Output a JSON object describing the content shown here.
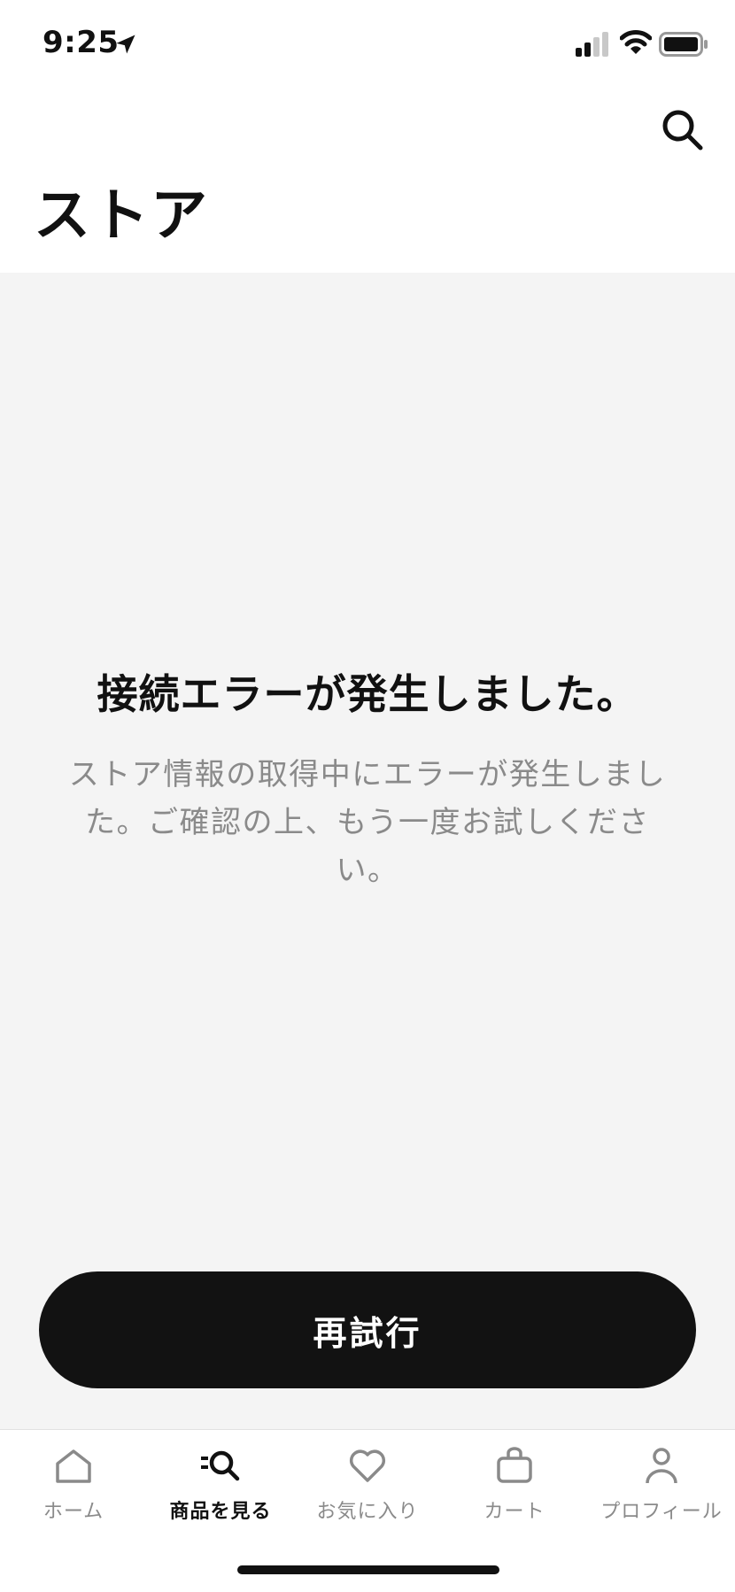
{
  "status_bar": {
    "time": "9:25"
  },
  "header": {
    "title": "ストア",
    "search_icon": "search-icon"
  },
  "error": {
    "title": "接続エラーが発生しました。",
    "message": "ストア情報の取得中にエラーが発生しました。ご確認の上、もう一度お試しください。"
  },
  "retry_button": {
    "label": "再試行"
  },
  "tab_bar": {
    "tabs": [
      {
        "label": "ホーム",
        "icon": "home-icon",
        "active": false
      },
      {
        "label": "商品を見る",
        "icon": "browse-icon",
        "active": true
      },
      {
        "label": "お気に入り",
        "icon": "heart-icon",
        "active": false
      },
      {
        "label": "カート",
        "icon": "bag-icon",
        "active": false
      },
      {
        "label": "プロフィール",
        "icon": "profile-icon",
        "active": false
      }
    ]
  },
  "colors": {
    "background": "#f4f4f4",
    "button": "#121212",
    "text_primary": "#111111",
    "text_secondary": "#8a8a8a"
  }
}
